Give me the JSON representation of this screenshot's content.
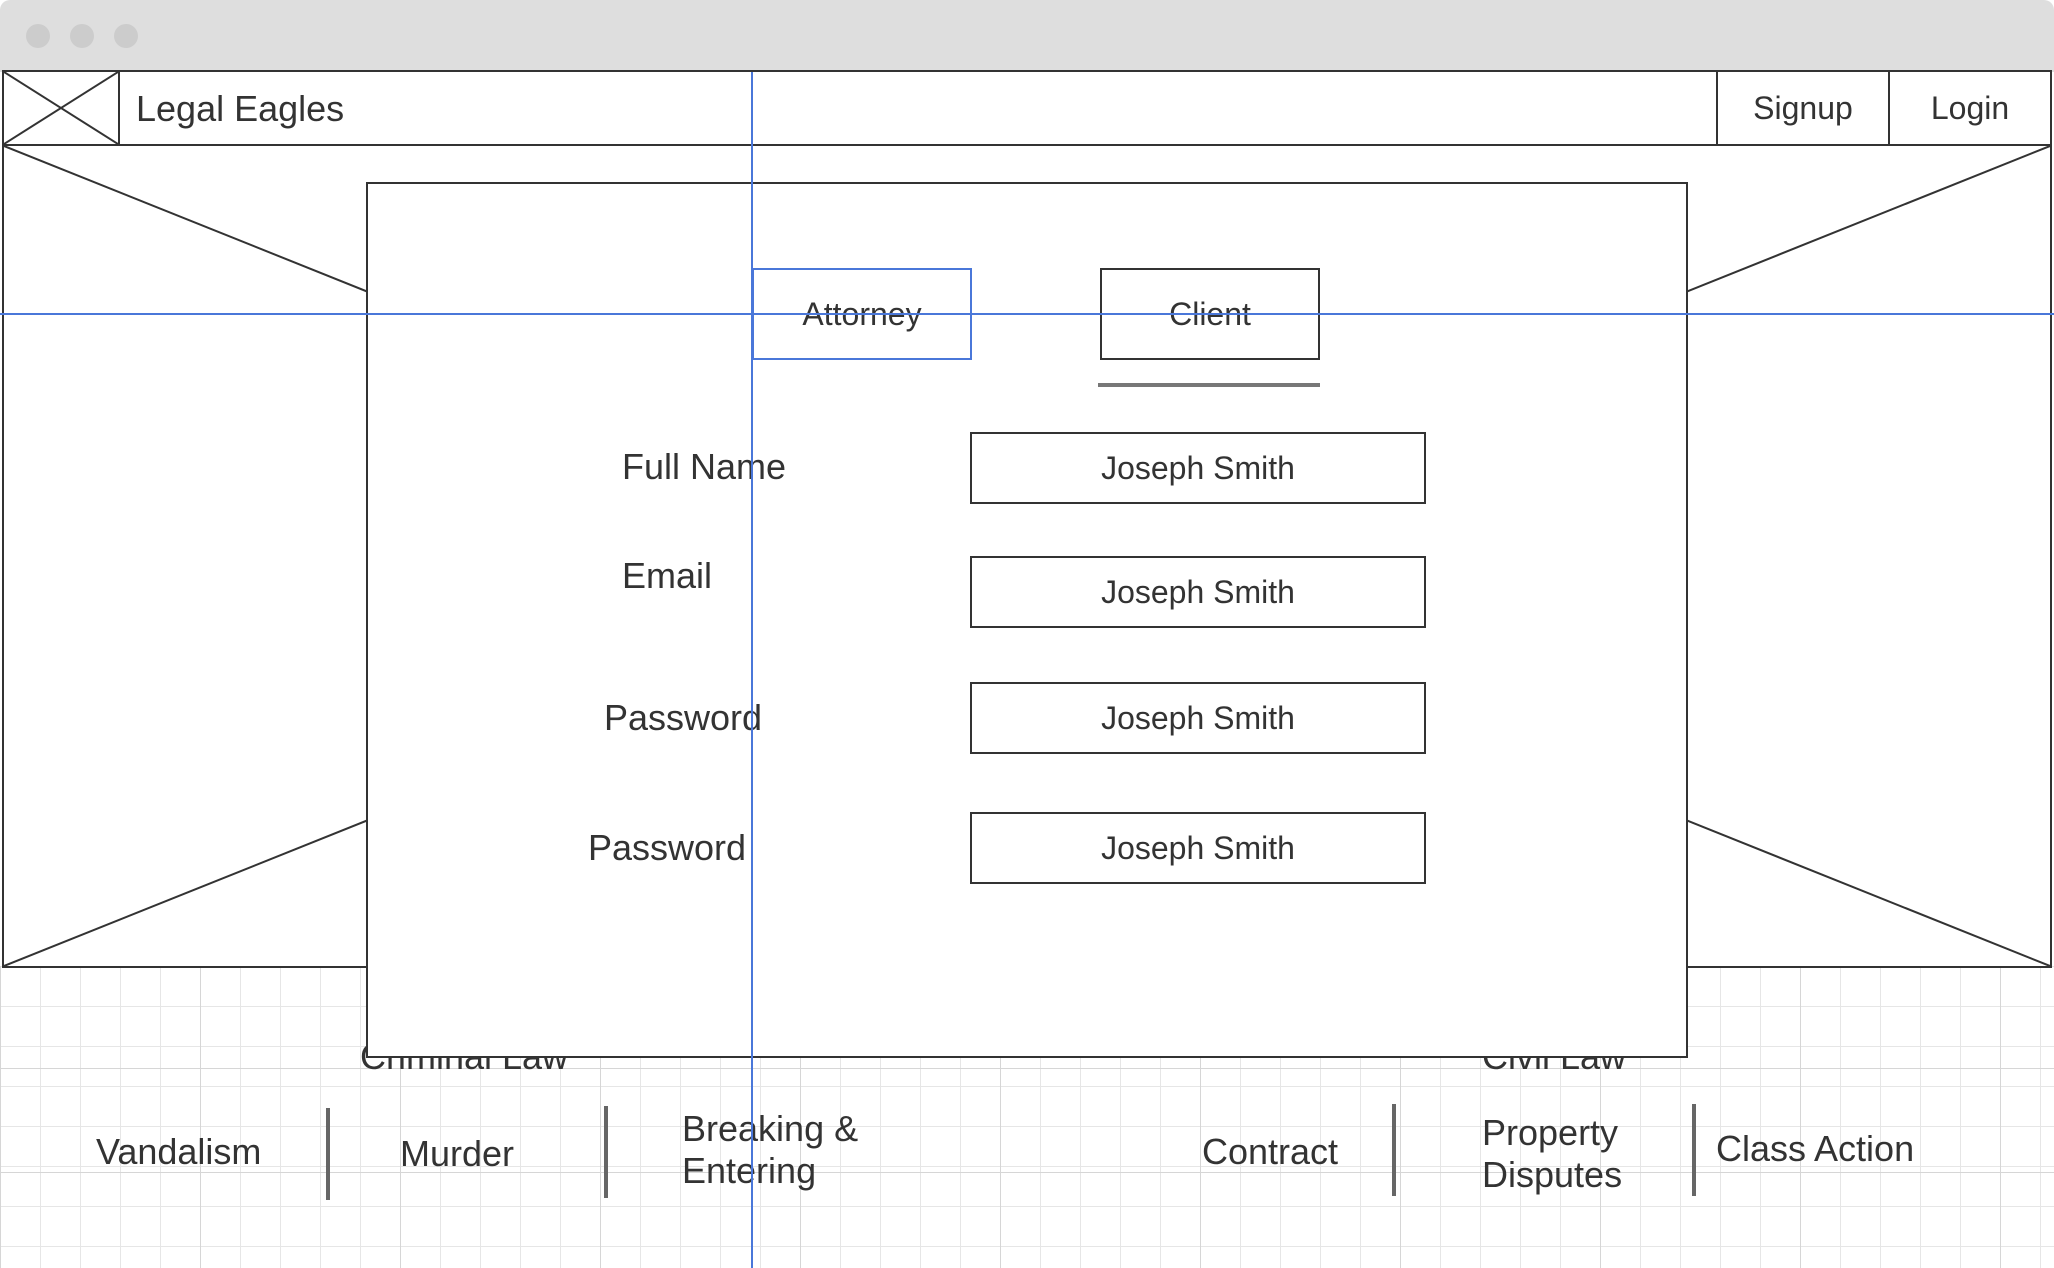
{
  "navbar": {
    "brand": "Legal Eagles",
    "signup": "Signup",
    "login": "Login"
  },
  "modal": {
    "tabs": {
      "attorney": "Attorney",
      "client": "Client"
    },
    "selected_tab": "client",
    "fields": [
      {
        "label": "Full Name",
        "value": "Joseph Smith"
      },
      {
        "label": "Email",
        "value": "Joseph Smith"
      },
      {
        "label": "Password",
        "value": "Joseph Smith"
      },
      {
        "label": "Password",
        "value": "Joseph Smith"
      }
    ]
  },
  "categories": {
    "criminal": {
      "heading": "Criminal Law",
      "items": [
        "Vandalism",
        "Murder",
        "Breaking & Entering"
      ]
    },
    "civil": {
      "heading": "Civil Law",
      "items": [
        "Contract",
        "Property Disputes",
        "Class Action"
      ]
    }
  },
  "colors": {
    "guide": "#4a77d9",
    "outline": "#333333",
    "titlebar": "#dedede"
  }
}
